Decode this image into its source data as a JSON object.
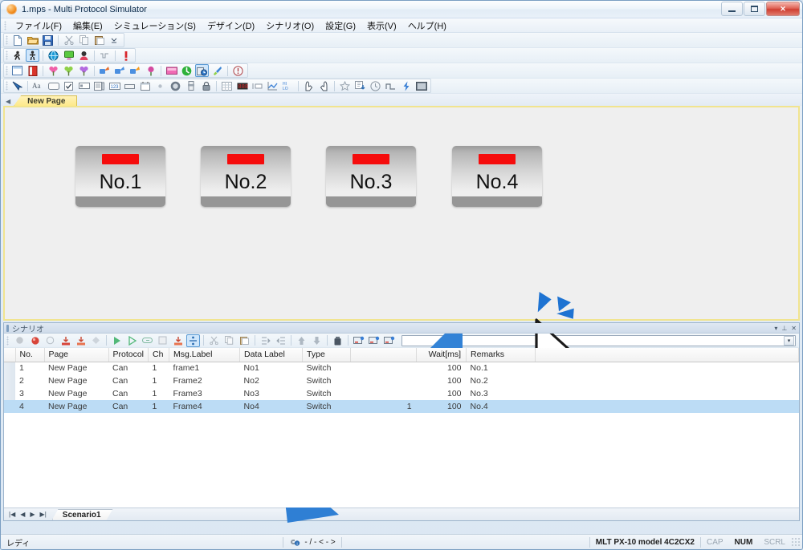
{
  "window": {
    "title": "1.mps - Multi Protocol Simulator",
    "icon": "app-icon",
    "buttons": {
      "minimize": "–",
      "maximize": "□",
      "close": "✕"
    }
  },
  "menubar": {
    "items": [
      {
        "label": "ファイル(F)",
        "name": "menu-file"
      },
      {
        "label": "編集(E)",
        "name": "menu-edit"
      },
      {
        "label": "シミュレーション(S)",
        "name": "menu-simulation"
      },
      {
        "label": "デザイン(D)",
        "name": "menu-design"
      },
      {
        "label": "シナリオ(O)",
        "name": "menu-scenario"
      },
      {
        "label": "設定(G)",
        "name": "menu-settings"
      },
      {
        "label": "表示(V)",
        "name": "menu-view"
      },
      {
        "label": "ヘルプ(H)",
        "name": "menu-help"
      }
    ]
  },
  "toolbars": {
    "row1": [
      "new-document-icon",
      "open-folder-icon",
      "save-disk-icon",
      "cut-scissors-icon",
      "copy-icon",
      "paste-icon",
      "overflow-chevron-icon"
    ],
    "row2": [
      "run-person-icon",
      "stop-person-icon",
      "globe-icon",
      "monitor-icon",
      "user-icon",
      "wave-icon",
      "alert-exclamation-icon"
    ],
    "row3": [
      "page-icon",
      "red-book-icon",
      "pin-pink-icon",
      "pin-green-icon",
      "pin-purple-icon",
      "link-blue-icon",
      "link-blue2-icon",
      "link-orange-icon",
      "balloon-icon",
      "screen-icon",
      "green-circle-icon",
      "clock-blue-icon",
      "brush-icon",
      "info-circle-icon"
    ],
    "row4": [
      "pointer-tool-icon",
      "text-tool-icon",
      "button-tool-icon",
      "checkbox-tool-icon",
      "textbox-tool-icon",
      "list-tool-icon",
      "number-tool-icon",
      "panel-tool-icon",
      "calendar-tool-icon",
      "dot-tool-icon",
      "gauge-tool-icon",
      "slider-tool-icon",
      "lock-tool-icon",
      "table-tool-icon",
      "seg-display-tool-icon",
      "bar-tool-icon",
      "matrix-tool-icon",
      "hilo-tool-icon",
      "hand-left-icon",
      "hand-right-icon",
      "star-icon",
      "import-icon",
      "clock-icon",
      "pulse-icon",
      "bolt-icon",
      "image-icon"
    ]
  },
  "page_tabs": {
    "nav_prev": "◀",
    "tabs": [
      {
        "label": "New Page",
        "active": true
      }
    ]
  },
  "canvas": {
    "background_color": "#efefef",
    "border_color": "#f1e48f",
    "devices": [
      {
        "label": "No.1",
        "led_color": "#f50c0c"
      },
      {
        "label": "No.2",
        "led_color": "#f50c0c"
      },
      {
        "label": "No.3",
        "led_color": "#f50c0c"
      },
      {
        "label": "No.4",
        "led_color": "#f50c0c"
      }
    ],
    "annotation": {
      "cursor": "mouse-pointer",
      "click_effect": "click-burst",
      "arrow_color": "#2f7fd4"
    }
  },
  "scenario_panel": {
    "title": "シナリオ",
    "panel_buttons": [
      "dropdown-icon",
      "pin-icon",
      "close-icon"
    ],
    "toolbar_icons": [
      "record-gray-icon",
      "record-red-icon",
      "circle-icon",
      "import-red-icon",
      "import-red2-icon",
      "diamond-icon",
      "play-icon",
      "play-outline-icon",
      "loop-icon",
      "stop-icon",
      "step-icon",
      "split-icon",
      "cut-icon",
      "copy-icon",
      "paste-icon",
      "indent-icon",
      "outdent-icon",
      "up-icon",
      "down-icon",
      "delete-trash-icon",
      "snapshot1-icon",
      "snapshot2-icon",
      "snapshot3-icon"
    ],
    "combo_value": "",
    "combo_arrow": "▾",
    "grid": {
      "columns": [
        "No.",
        "Page",
        "Protocol",
        "Ch",
        "Msg.Label",
        "Data Label",
        "Type",
        "",
        "Wait[ms]",
        "Remarks"
      ],
      "rows": [
        {
          "no": "1",
          "page": "New Page",
          "protocol": "Can",
          "ch": "1",
          "msg_label": "frame1",
          "data_label": "No1",
          "type": "Switch",
          "value": "",
          "wait": "100",
          "remarks": "No.1",
          "selected": false
        },
        {
          "no": "2",
          "page": "New Page",
          "protocol": "Can",
          "ch": "1",
          "msg_label": "Frame2",
          "data_label": "No2",
          "type": "Switch",
          "value": "",
          "wait": "100",
          "remarks": "No.2",
          "selected": false
        },
        {
          "no": "3",
          "page": "New Page",
          "protocol": "Can",
          "ch": "1",
          "msg_label": "Frame3",
          "data_label": "No3",
          "type": "Switch",
          "value": "",
          "wait": "100",
          "remarks": "No.3",
          "selected": false
        },
        {
          "no": "4",
          "page": "New Page",
          "protocol": "Can",
          "ch": "1",
          "msg_label": "Frame4",
          "data_label": "No4",
          "type": "Switch",
          "value": "1",
          "wait": "100",
          "remarks": "No.4",
          "selected": true
        }
      ]
    },
    "sheet_tabs": {
      "nav": [
        "|◀",
        "◀",
        "▶",
        "▶|"
      ],
      "tabs": [
        {
          "label": "Scenario1",
          "active": true
        }
      ]
    }
  },
  "statusbar": {
    "message": "レディ",
    "connection_icon": "link-status-icon",
    "connection_text": "- / - < - >",
    "device": "MLT PX-10 model 4C2CX2",
    "cap": "CAP",
    "num": "NUM",
    "scrl": "SCRL"
  }
}
